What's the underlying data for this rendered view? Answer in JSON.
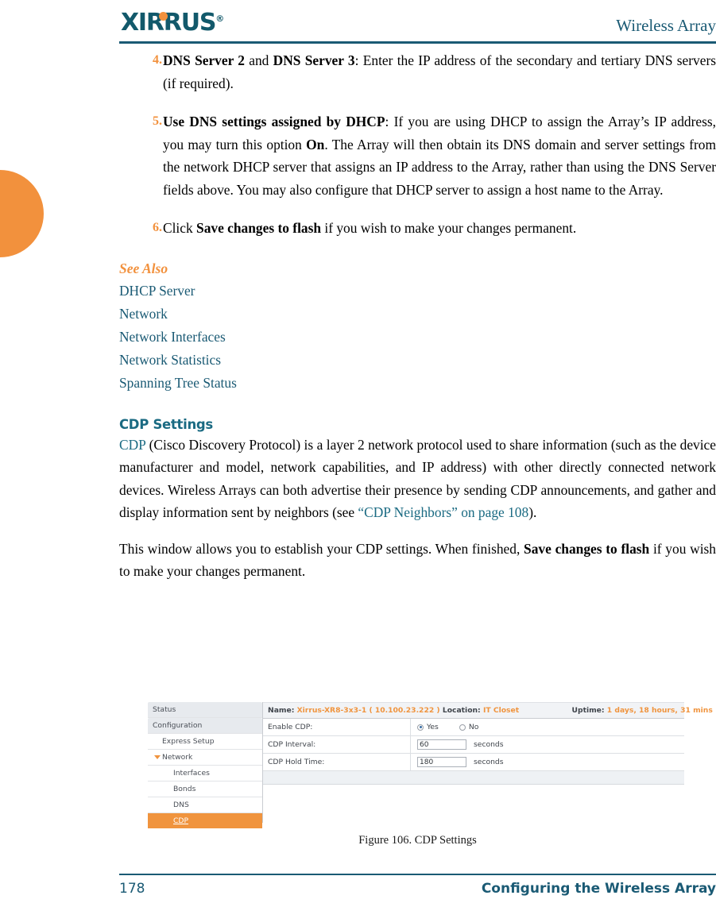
{
  "header": {
    "logo_text": "XIRRUS",
    "logo_reg": "®",
    "title": "Wireless Array"
  },
  "steps": [
    {
      "num": "4.",
      "lead": "DNS Server 2",
      "mid": " and ",
      "lead2": "DNS Server 3",
      "rest": ": Enter the IP address of the secondary and tertiary DNS servers (if required)."
    },
    {
      "num": "5.",
      "lead": "Use DNS settings assigned by DHCP",
      "rest_a": ": If you are using DHCP to assign the Array’s IP address, you may turn this option ",
      "bold_on": "On",
      "rest_b": ". The Array will then obtain its DNS domain and server settings from the network DHCP server that assigns an IP address to the Array, rather than using the DNS Server fields above. You may also configure that DHCP server to assign a host name to the Array."
    },
    {
      "num": "6.",
      "pre": "Click ",
      "bold": "Save changes to flash",
      "rest": " if you wish to make your changes permanent."
    }
  ],
  "see_also": {
    "heading": "See Also",
    "links": [
      "DHCP Server",
      "Network",
      "Network Interfaces",
      "Network Statistics",
      "Spanning Tree Status"
    ]
  },
  "cdp_section": {
    "heading": "CDP Settings",
    "para1_link": "CDP",
    "para1_a": " (Cisco Discovery Protocol) is a layer 2 network protocol used to share information (such as the device manufacturer and model, network capabilities, and IP address) with other directly connected network devices. Wireless Arrays can both advertise their presence by sending CDP announcements, and gather and display information sent by neighbors (see ",
    "para1_xref": "“CDP Neighbors” on page 108",
    "para1_b": ").",
    "para2_a": "This window allows you to establish your CDP settings. When finished, ",
    "para2_bold": "Save changes to flash",
    "para2_b": " if you wish to make your changes permanent."
  },
  "figure": {
    "caption": "Figure 106. CDP Settings",
    "sidebar": [
      {
        "label": "Status",
        "level": 0,
        "selected": false,
        "arrow": false
      },
      {
        "label": "Configuration",
        "level": 0,
        "selected": false,
        "arrow": false
      },
      {
        "label": "Express Setup",
        "level": 1,
        "selected": false,
        "arrow": false
      },
      {
        "label": "Network",
        "level": 1,
        "selected": false,
        "arrow": true
      },
      {
        "label": "Interfaces",
        "level": 2,
        "selected": false,
        "arrow": false
      },
      {
        "label": "Bonds",
        "level": 2,
        "selected": false,
        "arrow": false
      },
      {
        "label": "DNS",
        "level": 2,
        "selected": false,
        "arrow": false
      },
      {
        "label": "CDP",
        "level": 2,
        "selected": true,
        "arrow": false
      }
    ],
    "topbar": {
      "name_label": "Name:",
      "name_value": "Xirrus-XR8-3x3-1",
      "ip_value": "( 10.100.23.222 )",
      "location_label": "Location:",
      "location_value": "IT Closet",
      "uptime_label": "Uptime:",
      "uptime_value": "1 days, 18 hours, 31 mins"
    },
    "rows": {
      "enable_cdp_label": "Enable CDP:",
      "enable_cdp_yes": "Yes",
      "enable_cdp_no": "No",
      "enable_cdp_value": "Yes",
      "interval_label": "CDP Interval:",
      "interval_value": "60",
      "interval_unit": "seconds",
      "holdtime_label": "CDP Hold Time:",
      "holdtime_value": "180",
      "holdtime_unit": "seconds"
    }
  },
  "footer": {
    "page_number": "178",
    "title": "Configuring the Wireless Array"
  },
  "colors": {
    "teal": "#1A5A74",
    "orange": "#F2913D",
    "heading_teal": "#1A6A82",
    "selected_orange": "#F0943E"
  }
}
